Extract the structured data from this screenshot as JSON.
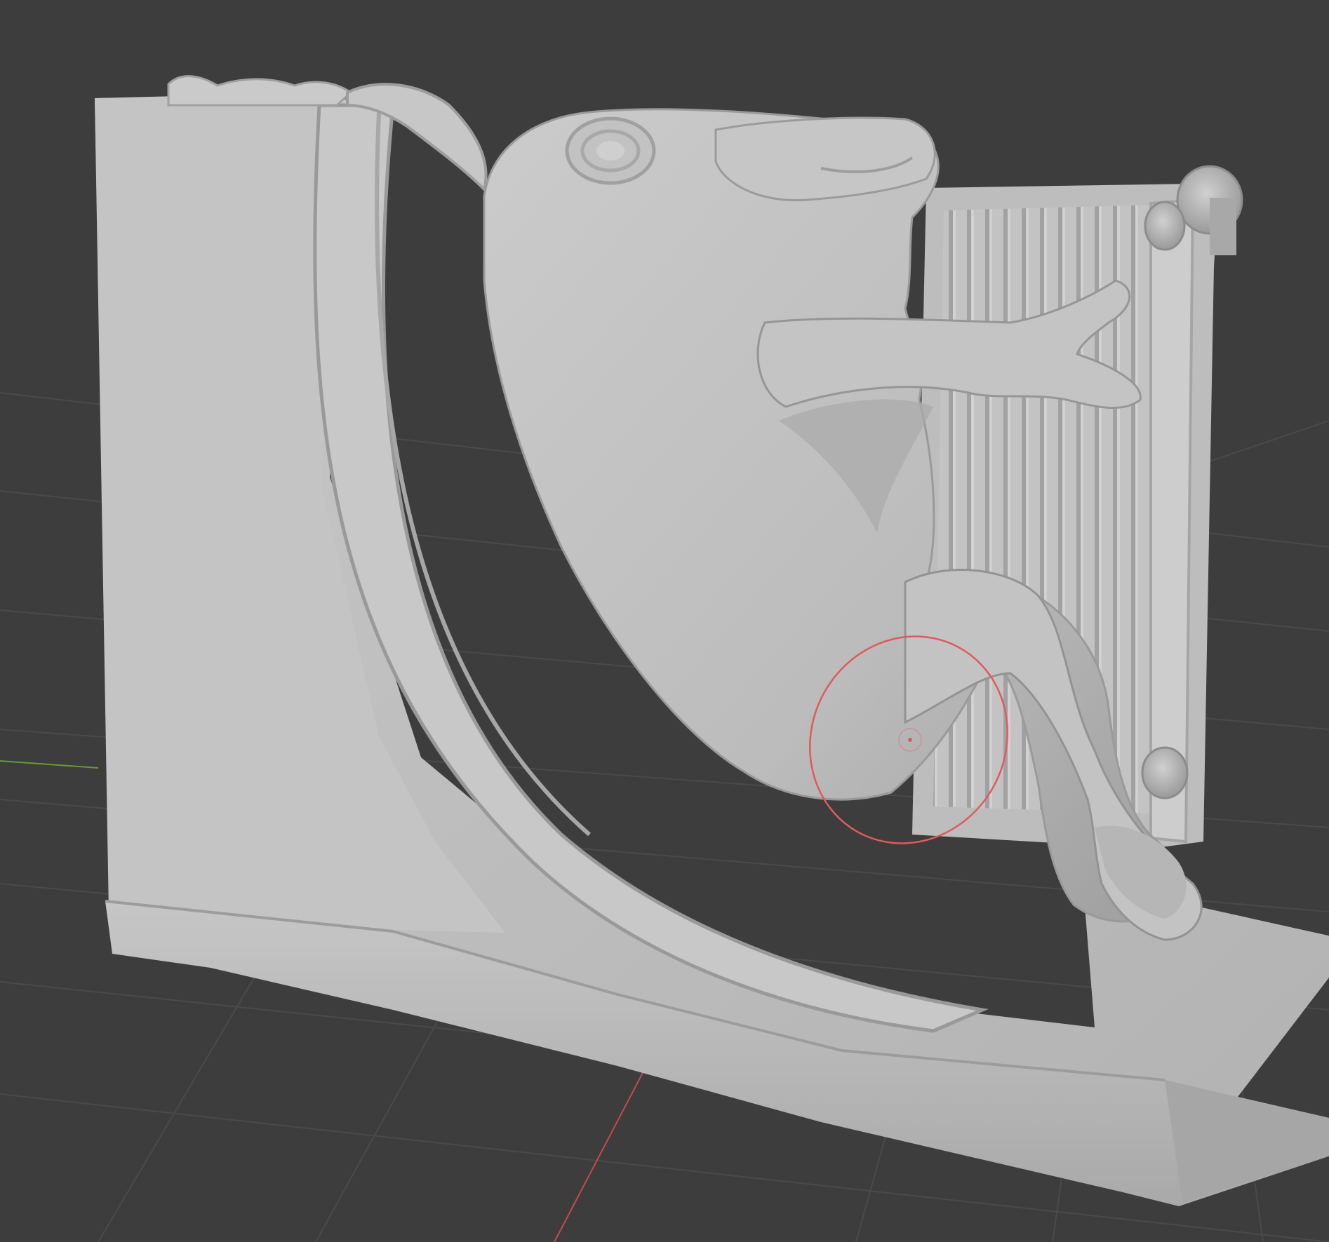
{
  "viewport": {
    "mode": "sculpt",
    "background_color": "#3d3d3d",
    "grid_color": "#4a4a4a",
    "x_axis_color": "#c24a52",
    "y_axis_color": "#6a9a2e"
  },
  "model": {
    "material_color": "#bdbdbd",
    "shadow_color": "#8e8e8e",
    "highlight_color": "#d6d6d6"
  },
  "brush_cursor": {
    "color": "#e05a5a",
    "icon": "sculpt-brush-circle-icon"
  }
}
